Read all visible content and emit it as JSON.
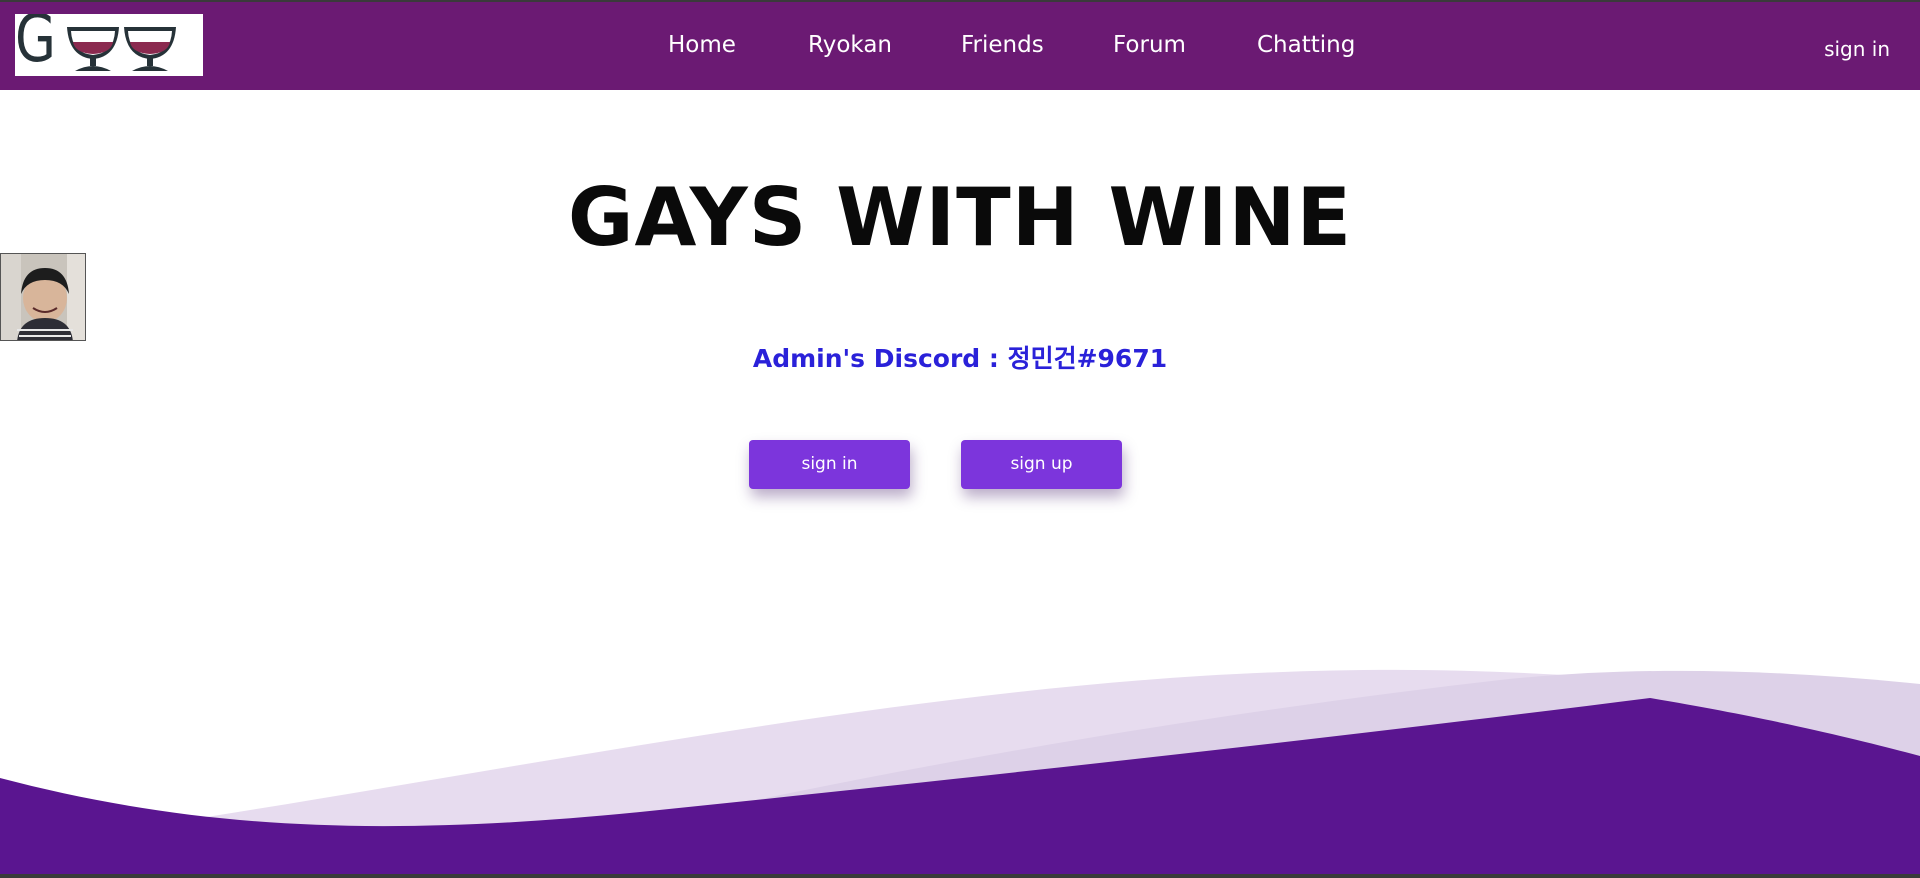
{
  "header": {
    "logo_letter": "G",
    "nav": [
      {
        "label": "Home"
      },
      {
        "label": "Ryokan"
      },
      {
        "label": "Friends"
      },
      {
        "label": "Forum"
      },
      {
        "label": "Chatting"
      }
    ],
    "signin_label": "sign in"
  },
  "hero": {
    "title": "GAYS WITH WINE",
    "discord_text": "Admin's Discord : 정민건#9671",
    "signin_button": "sign in",
    "signup_button": "sign up"
  },
  "colors": {
    "navbar": "#6b1a73",
    "button": "#7c35dc",
    "discord_text": "#2a21d9",
    "wave_dark": "#5a1590",
    "wave_light": "#dcd0ea",
    "wine": "#8b2a4f"
  },
  "icons": {
    "logo_glass_1": "wine-glass-icon",
    "logo_glass_2": "wine-glass-icon"
  }
}
